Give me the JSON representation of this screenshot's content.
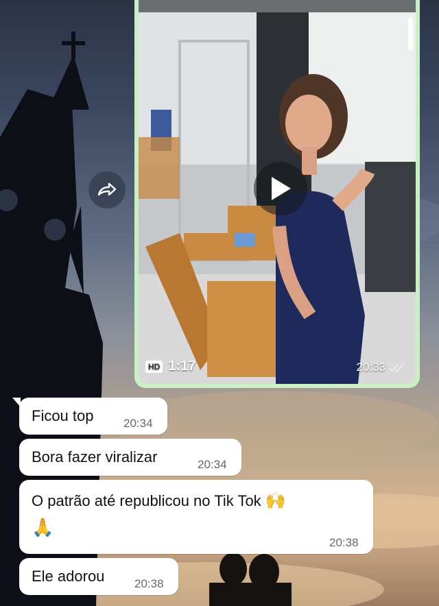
{
  "video_message": {
    "hd_label": "HD",
    "duration": "1:17",
    "time": "20:33",
    "play_icon": "play-icon",
    "status_icon": "double-check-icon"
  },
  "forward_icon": "forward-icon",
  "messages": [
    {
      "text": "Ficou top",
      "time": "20:34"
    },
    {
      "text": "Bora fazer viralizar",
      "time": "20:34"
    },
    {
      "text": "O patrão até republicou no Tik Tok",
      "emoji1": "🙌",
      "emoji2": "🙏",
      "time": "20:38"
    },
    {
      "text": "Ele adorou",
      "time": "20:38"
    }
  ]
}
